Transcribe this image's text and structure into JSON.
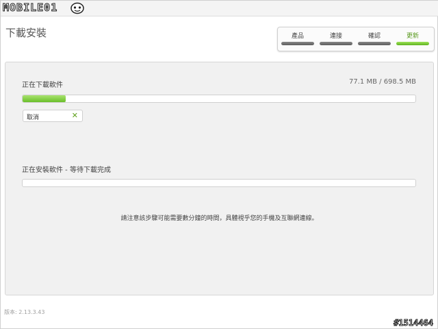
{
  "logo": {
    "text": "MOBILE01"
  },
  "page_title": "下載安裝",
  "steps": [
    {
      "label": "產品",
      "active": false
    },
    {
      "label": "連接",
      "active": false
    },
    {
      "label": "確認",
      "active": false
    },
    {
      "label": "更新",
      "active": true
    }
  ],
  "download": {
    "label": "正在下載軟件",
    "size_text": "77.1 MB / 698.5 MB",
    "progress": 0.11,
    "cancel_label": "取消",
    "cancel_icon": "close-icon"
  },
  "install": {
    "label": "正在安裝軟件 - 等待下載完成",
    "progress": 0.0
  },
  "note": "請注意該步驟可能需要數分鐘的時間，具體視乎您的手機及互聯網連線。",
  "version": "版本: 2.13.3.43",
  "watermark": "#1514464",
  "colors": {
    "accent_green": "#6abf2a",
    "active_step_text": "#5a9a20",
    "inactive_bar": "#6b6b6b"
  }
}
